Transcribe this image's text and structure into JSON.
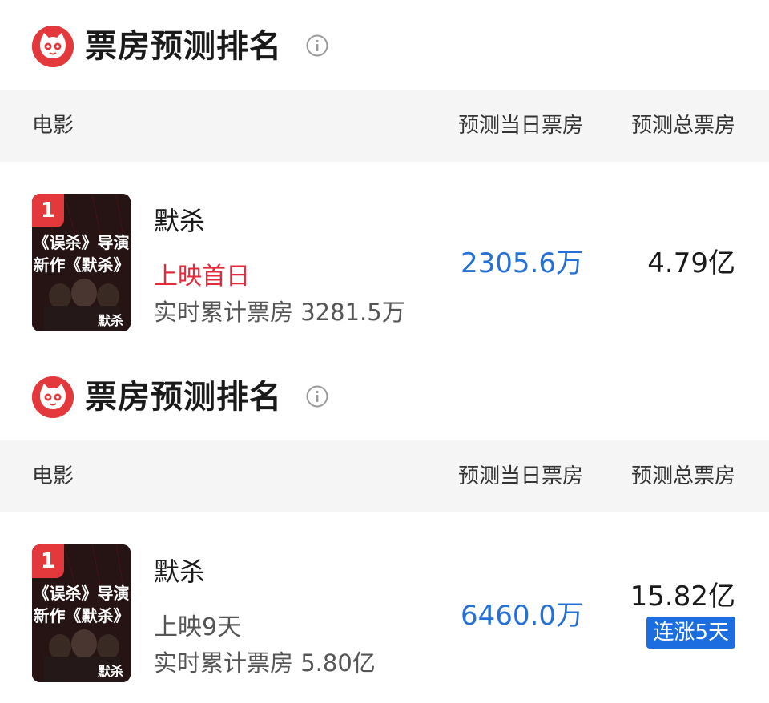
{
  "sections": [
    {
      "title": "票房预测排名",
      "headers": {
        "movie": "电影",
        "today": "预测当日票房",
        "total": "预测总票房"
      },
      "movie": {
        "rank": "1",
        "name": "默杀",
        "status": "上映首日",
        "cumulative": "实时累计票房 3281.5万",
        "today_forecast": "2305.6万",
        "total_forecast": "4.79亿",
        "poster_text": {
          "line1": "《误杀》导演",
          "line2": "新作《默杀》",
          "logo": "默杀"
        }
      }
    },
    {
      "title": "票房预测排名",
      "headers": {
        "movie": "电影",
        "today": "预测当日票房",
        "total": "预测总票房"
      },
      "movie": {
        "rank": "1",
        "name": "默杀",
        "status": "上映9天",
        "cumulative": "实时累计票房 5.80亿",
        "today_forecast": "6460.0万",
        "total_forecast": "15.82亿",
        "streak_badge": "连涨5天",
        "poster_text": {
          "line1": "《误杀》导演",
          "line2": "新作《默杀》",
          "logo": "默杀"
        }
      }
    }
  ],
  "colors": {
    "brand_red": "#e4393c",
    "forecast_blue": "#2470d8",
    "badge_blue": "#1c6ee0",
    "status_red": "#e4293a",
    "header_bg": "#f5f5f5"
  },
  "icons": {
    "logo": "maoyan-cat-logo-icon",
    "info": "info-circle-icon"
  }
}
